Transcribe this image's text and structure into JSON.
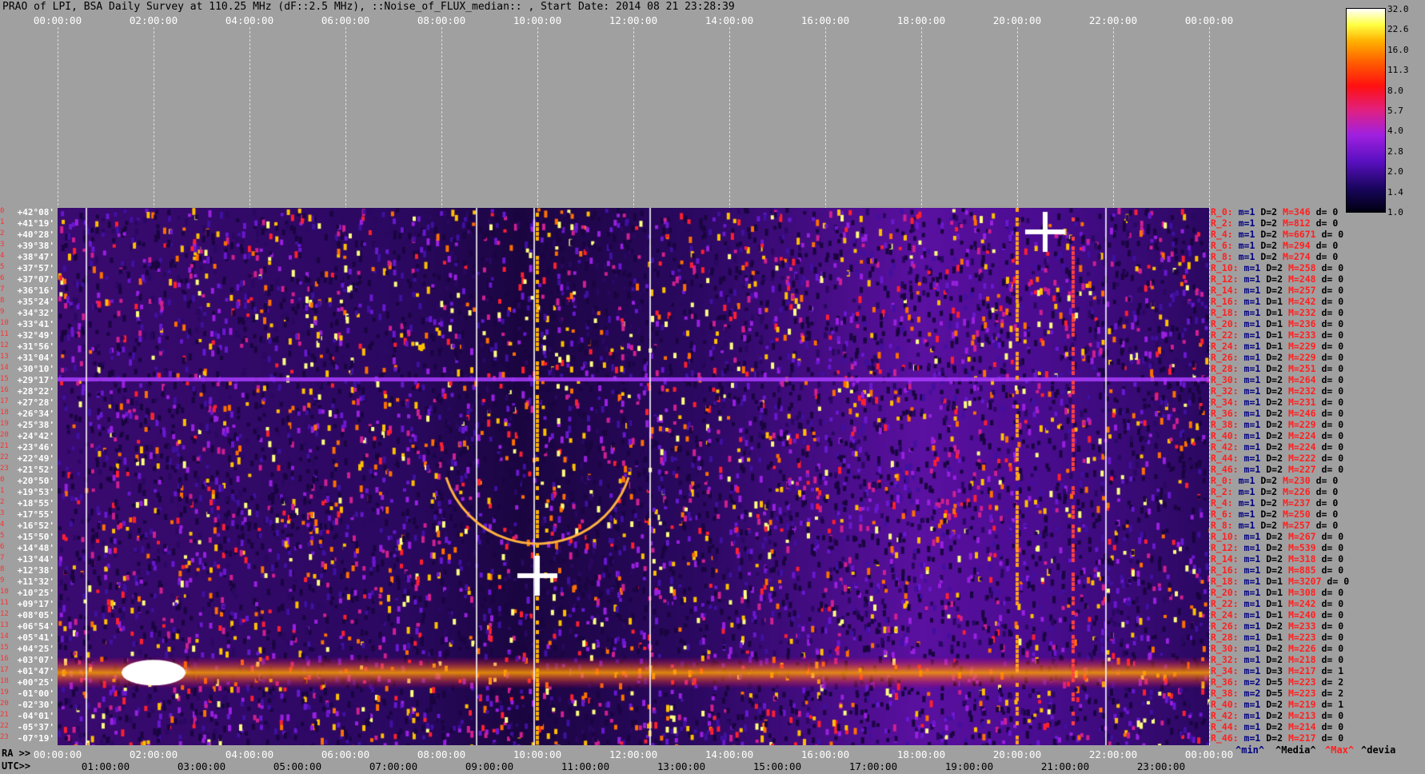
{
  "title": "PRAO of LPI, BSA Daily Survey at 110.25 MHz (dF::2.5 MHz), ::Noise_of_FLUX_median:: , Start Date: 2014 08 21 23:28:39",
  "top_ticks": [
    "00:00:00",
    "02:00:00",
    "04:00:00",
    "06:00:00",
    "08:00:00",
    "10:00:00",
    "12:00:00",
    "14:00:00",
    "16:00:00",
    "18:00:00",
    "20:00:00",
    "22:00:00",
    "00:00:00"
  ],
  "ra_label": "RA >>",
  "ra_ticks": [
    "00:00:00",
    "02:00:00",
    "04:00:00",
    "06:00:00",
    "08:00:00",
    "10:00:00",
    "12:00:00",
    "14:00:00",
    "16:00:00",
    "18:00:00",
    "20:00:00",
    "22:00:00",
    "00:00:00"
  ],
  "utc_label": "UTC>>",
  "utc_ticks": [
    "01:00:00",
    "03:00:00",
    "05:00:00",
    "07:00:00",
    "09:00:00",
    "11:00:00",
    "13:00:00",
    "15:00:00",
    "17:00:00",
    "19:00:00",
    "21:00:00",
    "23:00:00"
  ],
  "colorbar": {
    "labels": [
      "32.0",
      "22.6",
      "16.0",
      "11.3",
      "8.0",
      "5.7",
      "4.0",
      "2.8",
      "2.0",
      "1.4",
      "1.0"
    ]
  },
  "footer": {
    "min": "^min^",
    "media": "^Media^",
    "max": "^Max^",
    "devia": "^devia"
  },
  "declinations": [
    "+42°08'",
    "+41°19'",
    "+40°28'",
    "+39°38'",
    "+38°47'",
    "+37°57'",
    "+37°07'",
    "+36°16'",
    "+35°24'",
    "+34°32'",
    "+33°41'",
    "+32°49'",
    "+31°56'",
    "+31°04'",
    "+30°10'",
    "+29°17'",
    "+28°22'",
    "+27°28'",
    "+26°34'",
    "+25°38'",
    "+24°42'",
    "+23°46'",
    "+22°49'",
    "+21°52'",
    "+20°50'",
    "+19°53'",
    "+18°55'",
    "+17°55'",
    "+16°52'",
    "+15°50'",
    "+14°48'",
    "+13°44'",
    "+12°38'",
    "+11°32'",
    "+10°25'",
    "+09°17'",
    "+08°05'",
    "+06°54'",
    "+05°41'",
    "+04°25'",
    "+03°07'",
    "+01°47'",
    "+00°25'",
    "-01°00'",
    "-02°30'",
    "-04°01'",
    "-05°37'",
    "-07°19'"
  ],
  "stats": [
    [
      "R_0:",
      "m=1",
      "D=2",
      "M=346",
      "d= 0"
    ],
    [
      "R_2:",
      "m=1",
      "D=2",
      "M=812",
      "d= 0"
    ],
    [
      "R_4:",
      "m=1",
      "D=2",
      "M=6671",
      "d= 0"
    ],
    [
      "R_6:",
      "m=1",
      "D=2",
      "M=294",
      "d= 0"
    ],
    [
      "R_8:",
      "m=1",
      "D=2",
      "M=274",
      "d= 0"
    ],
    [
      "R_10:",
      "m=1",
      "D=2",
      "M=258",
      "d= 0"
    ],
    [
      "R_12:",
      "m=1",
      "D=2",
      "M=248",
      "d= 0"
    ],
    [
      "R_14:",
      "m=1",
      "D=2",
      "M=257",
      "d= 0"
    ],
    [
      "R_16:",
      "m=1",
      "D=1",
      "M=242",
      "d= 0"
    ],
    [
      "R_18:",
      "m=1",
      "D=1",
      "M=232",
      "d= 0"
    ],
    [
      "R_20:",
      "m=1",
      "D=1",
      "M=236",
      "d= 0"
    ],
    [
      "R_22:",
      "m=1",
      "D=1",
      "M=233",
      "d= 0"
    ],
    [
      "R_24:",
      "m=1",
      "D=1",
      "M=229",
      "d= 0"
    ],
    [
      "R_26:",
      "m=1",
      "D=2",
      "M=229",
      "d= 0"
    ],
    [
      "R_28:",
      "m=1",
      "D=2",
      "M=251",
      "d= 0"
    ],
    [
      "R_30:",
      "m=1",
      "D=2",
      "M=264",
      "d= 0"
    ],
    [
      "R_32:",
      "m=1",
      "D=2",
      "M=232",
      "d= 0"
    ],
    [
      "R_34:",
      "m=1",
      "D=2",
      "M=231",
      "d= 0"
    ],
    [
      "R_36:",
      "m=1",
      "D=2",
      "M=246",
      "d= 0"
    ],
    [
      "R_38:",
      "m=1",
      "D=2",
      "M=229",
      "d= 0"
    ],
    [
      "R_40:",
      "m=1",
      "D=2",
      "M=224",
      "d= 0"
    ],
    [
      "R_42:",
      "m=1",
      "D=2",
      "M=224",
      "d= 0"
    ],
    [
      "R_44:",
      "m=1",
      "D=2",
      "M=222",
      "d= 0"
    ],
    [
      "R_46:",
      "m=1",
      "D=2",
      "M=227",
      "d= 0"
    ],
    [
      "R_0:",
      "m=1",
      "D=2",
      "M=230",
      "d= 0"
    ],
    [
      "R_2:",
      "m=1",
      "D=2",
      "M=226",
      "d= 0"
    ],
    [
      "R_4:",
      "m=1",
      "D=2",
      "M=237",
      "d= 0"
    ],
    [
      "R_6:",
      "m=1",
      "D=2",
      "M=250",
      "d= 0"
    ],
    [
      "R_8:",
      "m=1",
      "D=2",
      "M=257",
      "d= 0"
    ],
    [
      "R_10:",
      "m=1",
      "D=2",
      "M=267",
      "d= 0"
    ],
    [
      "R_12:",
      "m=1",
      "D=2",
      "M=539",
      "d= 0"
    ],
    [
      "R_14:",
      "m=1",
      "D=2",
      "M=318",
      "d= 0"
    ],
    [
      "R_16:",
      "m=1",
      "D=2",
      "M=885",
      "d= 0"
    ],
    [
      "R_18:",
      "m=1",
      "D=1",
      "M=3207",
      "d= 0"
    ],
    [
      "R_20:",
      "m=1",
      "D=1",
      "M=308",
      "d= 0"
    ],
    [
      "R_22:",
      "m=1",
      "D=1",
      "M=242",
      "d= 0"
    ],
    [
      "R_24:",
      "m=1",
      "D=1",
      "M=240",
      "d= 0"
    ],
    [
      "R_26:",
      "m=1",
      "D=2",
      "M=233",
      "d= 0"
    ],
    [
      "R_28:",
      "m=1",
      "D=1",
      "M=223",
      "d= 0"
    ],
    [
      "R_30:",
      "m=1",
      "D=2",
      "M=226",
      "d= 0"
    ],
    [
      "R_32:",
      "m=1",
      "D=2",
      "M=218",
      "d= 0"
    ],
    [
      "R_34:",
      "m=1",
      "D=3",
      "M=217",
      "d= 1"
    ],
    [
      "R_36:",
      "m=2",
      "D=5",
      "M=223",
      "d= 2"
    ],
    [
      "R_38:",
      "m=2",
      "D=5",
      "M=223",
      "d= 2"
    ],
    [
      "R_40:",
      "m=1",
      "D=2",
      "M=219",
      "d= 1"
    ],
    [
      "R_42:",
      "m=1",
      "D=2",
      "M=213",
      "d= 0"
    ],
    [
      "R_44:",
      "m=1",
      "D=2",
      "M=214",
      "d= 0"
    ],
    [
      "R_46:",
      "m=1",
      "D=2",
      "M=217",
      "d= 0"
    ]
  ],
  "colors": {
    "background": "#a0a0a0",
    "accent_red": "#ff2020",
    "text_navy": "#000080"
  }
}
